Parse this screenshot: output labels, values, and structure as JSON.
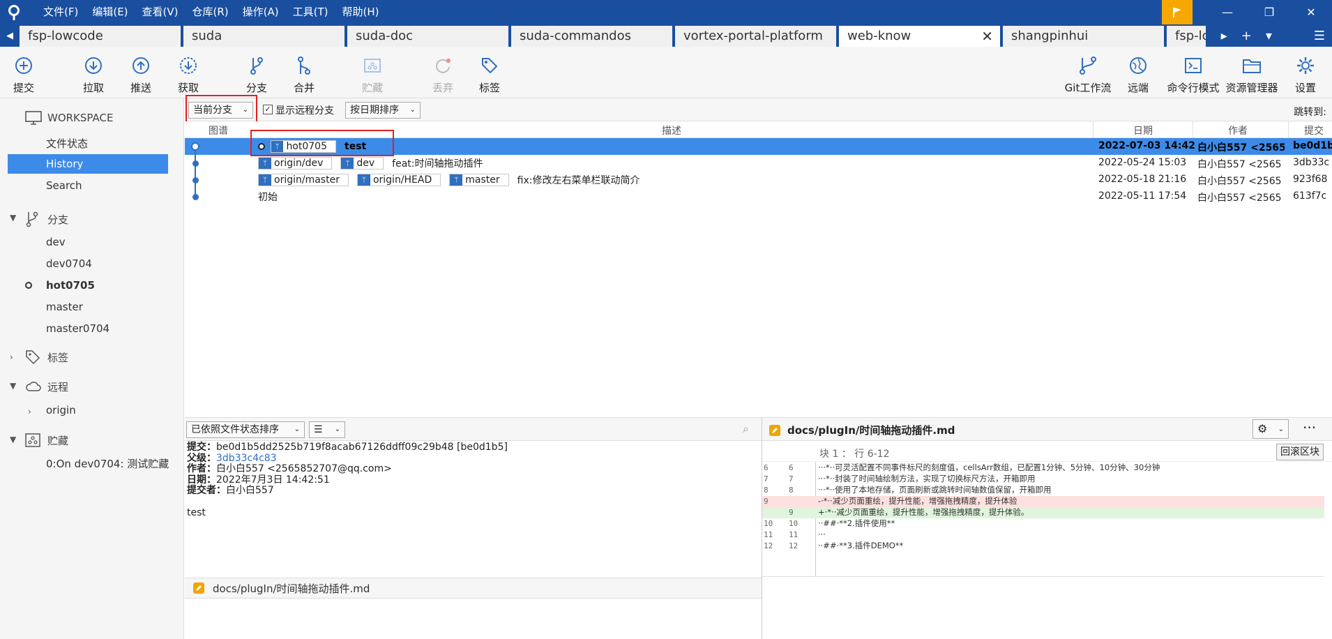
{
  "menu": [
    "文件(F)",
    "编辑(E)",
    "查看(V)",
    "仓库(R)",
    "操作(A)",
    "工具(T)",
    "帮助(H)"
  ],
  "tabs": [
    {
      "label": "fsp-lowcode",
      "active": false
    },
    {
      "label": "suda",
      "active": false
    },
    {
      "label": "suda-doc",
      "active": false
    },
    {
      "label": "suda-commandos",
      "active": false
    },
    {
      "label": "vortex-portal-platform",
      "active": false
    },
    {
      "label": "web-know",
      "active": true
    },
    {
      "label": "shangpinhui",
      "active": false
    },
    {
      "label": "fsp-lo",
      "active": false
    }
  ],
  "toolbar": {
    "commit": "提交",
    "pull": "拉取",
    "push": "推送",
    "fetch": "获取",
    "branch": "分支",
    "merge": "合并",
    "stash": "贮藏",
    "discard": "丢弃",
    "tag": "标签",
    "gitflow": "Git工作流",
    "remote": "远端",
    "terminal": "命令行模式",
    "explorer": "资源管理器",
    "settings": "设置"
  },
  "sidebar": {
    "workspace": "WORKSPACE",
    "file_status": "文件状态",
    "history": "History",
    "search": "Search",
    "branches_label": "分支",
    "branches": [
      "dev",
      "dev0704",
      "hot0705",
      "master",
      "master0704"
    ],
    "tags_label": "标签",
    "remotes_label": "远程",
    "remote_origin": "origin",
    "stashes_label": "贮藏",
    "stash_item": "0:On dev0704: 测试贮藏"
  },
  "filter": {
    "branch_select": "当前分支",
    "show_remote": "显示远程分支",
    "sort_select": "按日期排序",
    "jump_to": "跳转到:"
  },
  "list_headers": {
    "graph": "图谱",
    "description": "描述",
    "date": "日期",
    "author": "作者",
    "commit": "提交"
  },
  "commits": [
    {
      "refs": [
        "hot0705"
      ],
      "message": "test",
      "date": "2022-07-03 14:42",
      "author": "白小白557 <2565",
      "hash": "be0d1b"
    },
    {
      "refs": [
        "origin/dev",
        "dev"
      ],
      "message": "feat:时间轴拖动插件",
      "date": "2022-05-24 15:03",
      "author": "白小白557 <2565",
      "hash": "3db33c"
    },
    {
      "refs": [
        "origin/master",
        "origin/HEAD",
        "master"
      ],
      "message": "fix:修改左右菜单栏联动简介",
      "date": "2022-05-18 21:16",
      "author": "白小白557 <2565",
      "hash": "923f68"
    },
    {
      "refs": [],
      "message": "初始",
      "date": "2022-05-11 17:54",
      "author": "白小白557 <2565",
      "hash": "613f7c"
    }
  ],
  "files_panel": {
    "sort_select": "已依照文件状态排序",
    "file": "docs/plugIn/时间轴拖动插件.md"
  },
  "details": {
    "commit_key": "提交：",
    "commit_val": "be0d1b5dd2525b719f8acab67126ddff09c29b48 [be0d1b5]",
    "parent_key": "父级：",
    "parent_val": "3db33c4c83",
    "author_key": "作者：",
    "author_val": "白小白557 <2565852707@qq.com>",
    "date_key": "日期：",
    "date_val": "2022年7月3日 14:42:51",
    "committer_key": "提交者：",
    "committer_val": "白小白557",
    "message": "test"
  },
  "diff": {
    "file": "docs/plugIn/时间轴拖动插件.md",
    "hunk": "块 1 ： 行 6-12",
    "revert": "回滚区块",
    "lines": [
      {
        "old": "6",
        "new": "6",
        "type": "ctx",
        "text": "···*··可灵活配置不同事件标尺的刻度值，cellsArr数组，已配置1分钟、5分钟、10分钟、30分钟"
      },
      {
        "old": "7",
        "new": "7",
        "type": "ctx",
        "text": "···*··封装了时间轴绘制方法，实现了切换标尺方法，开箱即用"
      },
      {
        "old": "8",
        "new": "8",
        "type": "ctx",
        "text": "···*··使用了本地存储，页面刷新或跳转时间轴数值保留，开箱即用"
      },
      {
        "old": "9",
        "new": "",
        "type": "del",
        "text": "-·*··减少页面重绘，提升性能，增强拖拽精度，提升体验"
      },
      {
        "old": "",
        "new": "9",
        "type": "add",
        "text": "+·*··减少页面重绘，提升性能，增强拖拽精度，提升体验。"
      },
      {
        "old": "10",
        "new": "10",
        "type": "ctx",
        "text": "··##·**2.插件使用**"
      },
      {
        "old": "11",
        "new": "11",
        "type": "ctx",
        "text": "···"
      },
      {
        "old": "12",
        "new": "12",
        "type": "ctx",
        "text": "··##·**3.插件DEMO**"
      }
    ]
  },
  "colors": {
    "title_bar": "#1a4f9f",
    "selection": "#3d8be8",
    "accent": "#2f6fc0",
    "highlight_box": "#e02020",
    "flag": "#f6a800"
  }
}
